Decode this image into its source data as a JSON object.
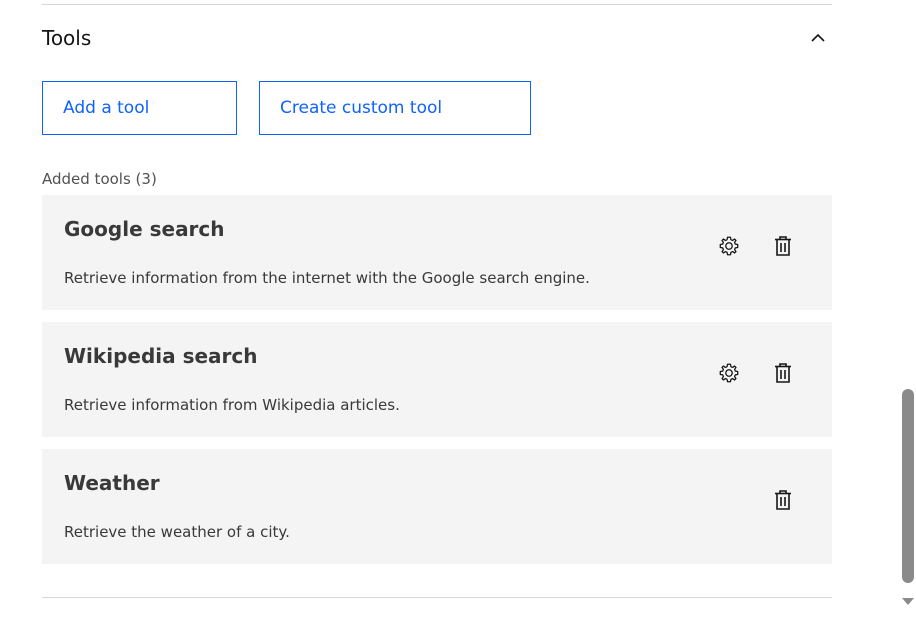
{
  "section": {
    "title": "Tools",
    "collapse_icon": "chevron-up-icon"
  },
  "actions": {
    "add_tool_label": "Add a tool",
    "create_custom_label": "Create custom tool"
  },
  "added_tools": {
    "label": "Added tools (3)",
    "items": [
      {
        "name": "Google search",
        "description": "Retrieve information from the internet with the Google search engine.",
        "has_settings": true,
        "icons": [
          "gear-icon",
          "trash-icon"
        ]
      },
      {
        "name": "Wikipedia search",
        "description": "Retrieve information from Wikipedia articles.",
        "has_settings": true,
        "icons": [
          "gear-icon",
          "trash-icon"
        ]
      },
      {
        "name": "Weather",
        "description": "Retrieve the weather of a city.",
        "has_settings": false,
        "icons": [
          "trash-icon"
        ]
      }
    ]
  },
  "colors": {
    "accent": "#0f62fe",
    "card_background": "#f4f4f4",
    "text_primary": "#161616",
    "text_secondary": "#525252"
  }
}
